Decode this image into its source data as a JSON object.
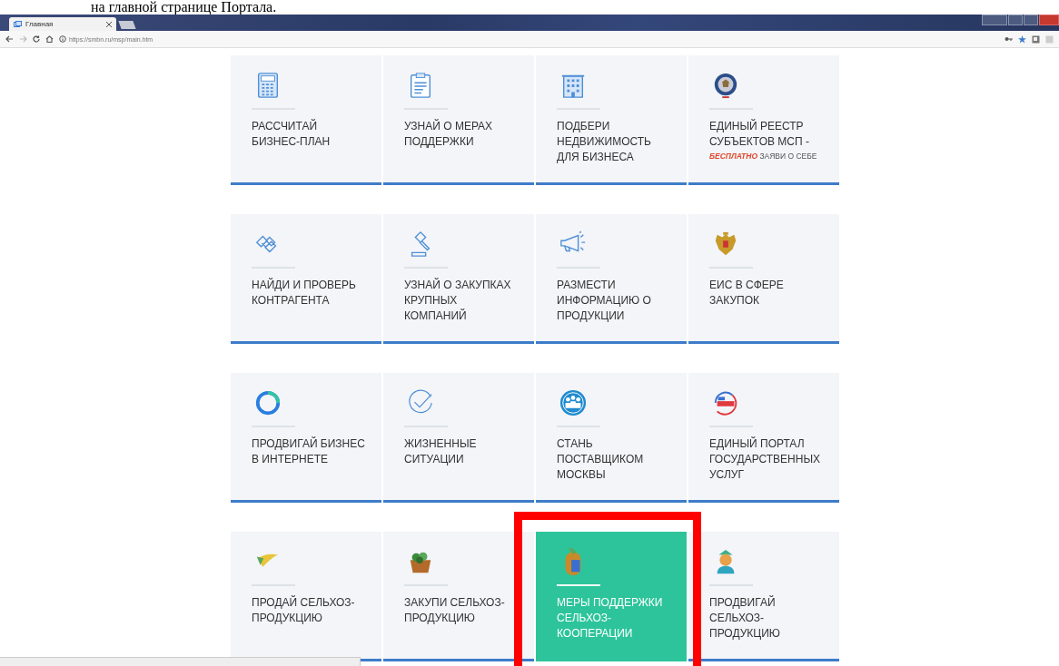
{
  "document_caption": "на главной странице Портала.",
  "browser": {
    "tab_title": "Главная",
    "url": "https://smbn.ru/msp/main.htm"
  },
  "tiles": [
    {
      "title": "РАССЧИТАЙ БИЗНЕС-ПЛАН",
      "selected": false
    },
    {
      "title": "УЗНАЙ О МЕРАХ ПОДДЕРЖКИ",
      "selected": false
    },
    {
      "title": "ПОДБЕРИ НЕДВИЖИМОСТЬ ДЛЯ БИЗНЕСА",
      "selected": false
    },
    {
      "title": "ЕДИНЫЙ РЕЕСТР СУБЪЕКТОВ МСП -",
      "note": "**БЕСПЛАТНО** ЗАЯВИ О СЕБЕ",
      "selected": false
    },
    {
      "title": "НАЙДИ И ПРОВЕРЬ КОНТРАГЕНТА",
      "selected": false
    },
    {
      "title": "УЗНАЙ О ЗАКУПКАХ КРУПНЫХ КОМПАНИЙ",
      "selected": false
    },
    {
      "title": "РАЗМЕСТИ ИНФОРМАЦИЮ О ПРОДУКЦИИ",
      "selected": false
    },
    {
      "title": "ЕИС В СФЕРЕ ЗАКУПОК",
      "selected": false
    },
    {
      "title": "ПРОДВИГАЙ БИЗНЕС В ИНТЕРНЕТЕ",
      "selected": false
    },
    {
      "title": "ЖИЗНЕННЫЕ СИТУАЦИИ",
      "selected": false
    },
    {
      "title": "СТАНЬ ПОСТАВЩИКОМ МОСКВЫ",
      "selected": false
    },
    {
      "title": "ЕДИНЫЙ ПОРТАЛ ГОСУДАРСТВЕННЫХ УСЛУГ",
      "selected": false
    },
    {
      "title": "ПРОДАЙ СЕЛЬХОЗ-ПРОДУКЦИЮ",
      "selected": false
    },
    {
      "title": "ЗАКУПИ СЕЛЬХОЗ-ПРОДУКЦИЮ",
      "selected": false
    },
    {
      "title": "МЕРЫ ПОДДЕРЖКИ СЕЛЬХОЗ-КООПЕРАЦИИ",
      "selected": true
    },
    {
      "title": "ПРОДВИГАЙ СЕЛЬХОЗ-ПРОДУКЦИЮ",
      "selected": false
    }
  ]
}
